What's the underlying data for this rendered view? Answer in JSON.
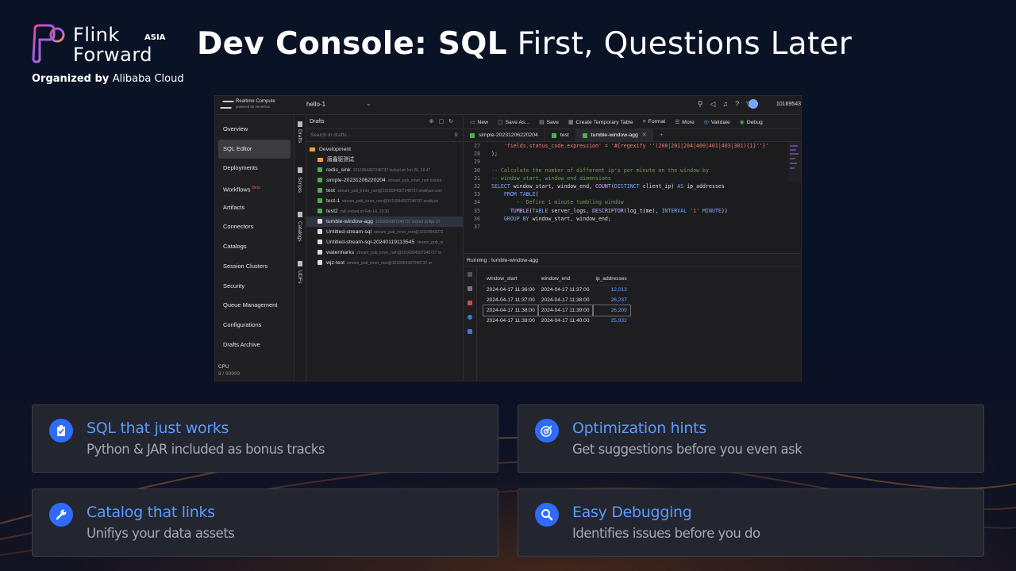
{
  "logo": {
    "line1": "Flink",
    "line2": "Forward",
    "region": "ASIA",
    "organized": "Organized by",
    "organizer": "Alibaba Cloud"
  },
  "title": {
    "bold": "Dev Console: SQL",
    "rest": " First, Questions Later"
  },
  "app": {
    "brand": {
      "name": "Realtime Compute",
      "powered": "powered by ververica"
    },
    "workspace": "hello-1",
    "account": "10169543",
    "nav": [
      "Overview",
      "SQL Editor",
      "Deployments",
      "Workflows",
      "Artifacts",
      "Connectors",
      "Catalogs",
      "Session Clusters",
      "Security",
      "Queue Management",
      "Configurations",
      "Drafts Archive"
    ],
    "nav_beta": "Beta",
    "cpu_label": "CPU",
    "cpu_value": "9 / 99999",
    "vtabs": [
      "Drafts",
      "Scripts",
      "Catalogs",
      "UDFs"
    ],
    "drafts_title": "Drafts",
    "search_placeholder": "Search in drafts...",
    "tree": [
      {
        "name": "Development",
        "kind": "folder",
        "meta": ""
      },
      {
        "name": "唐鑫驱测试",
        "kind": "folder",
        "meta": ""
      },
      {
        "name": "redis_sink",
        "kind": "green",
        "meta": "1016954307248737 locked at Jun 26, 16:47"
      },
      {
        "name": "simple-20231206220204",
        "kind": "green",
        "meta": "stream_pub_inner_ram locked"
      },
      {
        "name": "test",
        "kind": "green",
        "meta": "stream_pub_inner_ram@1016954307248737.onaliyun.com"
      },
      {
        "name": "test-1",
        "kind": "green",
        "meta": "stream_pub_inner_ram@1016954307248737.onaliyun"
      },
      {
        "name": "test2",
        "kind": "green",
        "meta": "null locked at Feb 14, 15:30"
      },
      {
        "name": "tumble-window-agg",
        "kind": "white",
        "meta": "1016954307248737 locked at Apr 17"
      },
      {
        "name": "Untitled-stream-sql",
        "kind": "white",
        "meta": "stream_pub_inner_ram@10169543072"
      },
      {
        "name": "Untitled-stream-sql-20240119113545",
        "kind": "white",
        "meta": "stream_pub_in"
      },
      {
        "name": "watermarks",
        "kind": "white",
        "meta": "stream_pub_inner_ram@1016954307248737.or"
      },
      {
        "name": "wjz-test",
        "kind": "white",
        "meta": "stream_pub_inner_ram@1016954307248737.or"
      }
    ],
    "toolbar": [
      "New",
      "Save As...",
      "Save",
      "Create Temporary Table",
      "Format",
      "More",
      "Validate",
      "Debug"
    ],
    "tabs": [
      "simple-20231206220204",
      "test",
      "tumble-window-agg"
    ],
    "code": [
      {
        "n": "27",
        "parts": [
          [
            "c-str",
            "    'fields.status_code.expression' = '#{regexify ''(200|201|204|400|401|403|301){1}''}'"
          ]
        ]
      },
      {
        "n": "28",
        "parts": [
          [
            "c-pl",
            ");"
          ]
        ]
      },
      {
        "n": "29",
        "parts": [
          [
            "c-pl",
            ""
          ]
        ]
      },
      {
        "n": "30",
        "parts": [
          [
            "c-com",
            "-- Calculate the number of different ip's per minute on the window by"
          ]
        ]
      },
      {
        "n": "31",
        "parts": [
          [
            "c-com",
            "-- window_start, window_end dimensions"
          ]
        ]
      },
      {
        "n": "32",
        "parts": [
          [
            "c-kw",
            "SELECT"
          ],
          [
            "c-pl",
            " window_start, window_end, "
          ],
          [
            "c-fn",
            "COUNT"
          ],
          [
            "c-pl",
            "("
          ],
          [
            "c-kw",
            "DISTINCT"
          ],
          [
            "c-pl",
            " client_ip) "
          ],
          [
            "c-kw",
            "AS"
          ],
          [
            "c-pl",
            " ip_addresses"
          ]
        ]
      },
      {
        "n": "33",
        "parts": [
          [
            "c-pl",
            "    "
          ],
          [
            "c-kw",
            "FROM TABLE"
          ],
          [
            "c-pl",
            "("
          ]
        ]
      },
      {
        "n": "34",
        "parts": [
          [
            "c-com",
            "        -- Define 1 minute tumbling window"
          ]
        ]
      },
      {
        "n": "35",
        "parts": [
          [
            "c-pl",
            "      "
          ],
          [
            "c-fn",
            "TUMBLE"
          ],
          [
            "c-pl",
            "("
          ],
          [
            "c-kw",
            "TABLE"
          ],
          [
            "c-pl",
            " server_logs, "
          ],
          [
            "c-fn",
            "DESCRIPTOR"
          ],
          [
            "c-pl",
            "(log_time), "
          ],
          [
            "c-kw",
            "INTERVAL"
          ],
          [
            "c-str",
            " '1'"
          ],
          [
            "c-kw",
            " MINUTE"
          ],
          [
            "c-pl",
            "))"
          ]
        ]
      },
      {
        "n": "36",
        "parts": [
          [
            "c-pl",
            "    "
          ],
          [
            "c-kw",
            "GROUP BY"
          ],
          [
            "c-pl",
            " window_start, window_end;"
          ]
        ]
      },
      {
        "n": "37",
        "parts": [
          [
            "c-pl",
            ""
          ]
        ]
      }
    ],
    "running": "Running : tumble-window-agg",
    "result_columns": [
      "window_start",
      "window_end",
      "ip_addresses"
    ],
    "result_rows": [
      [
        "2024-04-17 11:36:00",
        "2024-04-17 11:37:00",
        "12,013"
      ],
      [
        "2024-04-17 11:37:00",
        "2024-04-17 11:38:00",
        "26,237"
      ],
      [
        "2024-04-17 11:38:00",
        "2024-04-17 11:39:00",
        "26,209"
      ],
      [
        "2024-04-17 11:39:00",
        "2024-04-17 11:40:00",
        "25,932"
      ]
    ]
  },
  "cards": [
    {
      "title": "SQL that just works",
      "sub": "Python & JAR included as bonus tracks",
      "icon": "clipboard-check-icon"
    },
    {
      "title": "Optimization hints",
      "sub": "Get suggestions before you even ask",
      "icon": "target-icon"
    },
    {
      "title": "Catalog that links",
      "sub": "Unifiys your data assets",
      "icon": "wrench-icon"
    },
    {
      "title": "Easy Debugging",
      "sub": "Identifies issues before you do",
      "icon": "magnifier-icon"
    }
  ],
  "colors": {
    "accent": "#2f6bff",
    "card_title": "#5b9bff",
    "background": "#0a1226"
  }
}
